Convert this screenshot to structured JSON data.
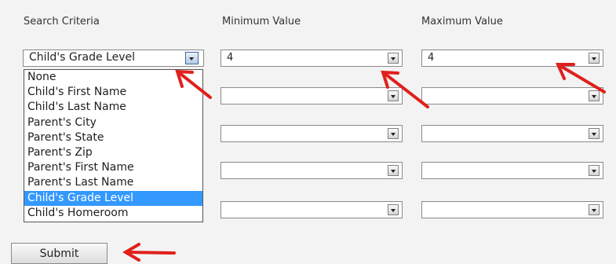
{
  "headers": {
    "criteria": "Search Criteria",
    "min": "Minimum Value",
    "max": "Maximum Value"
  },
  "criteria_select": {
    "value": "Child's Grade Level"
  },
  "dropdown_options": [
    "None",
    "Child's First Name",
    "Child's Last Name",
    "Parent's City",
    "Parent's State",
    "Parent's Zip",
    "Parent's First Name",
    "Parent's Last Name",
    "Child's Grade Level",
    "Child's Homeroom"
  ],
  "highlighted_option": "Child's Grade Level",
  "rows": [
    {
      "min": "4",
      "max": "4"
    },
    {
      "min": "",
      "max": ""
    },
    {
      "min": "",
      "max": ""
    },
    {
      "min": "",
      "max": ""
    },
    {
      "min": "",
      "max": ""
    }
  ],
  "submit_label": "Submit",
  "annotation_color": "#e0201c"
}
